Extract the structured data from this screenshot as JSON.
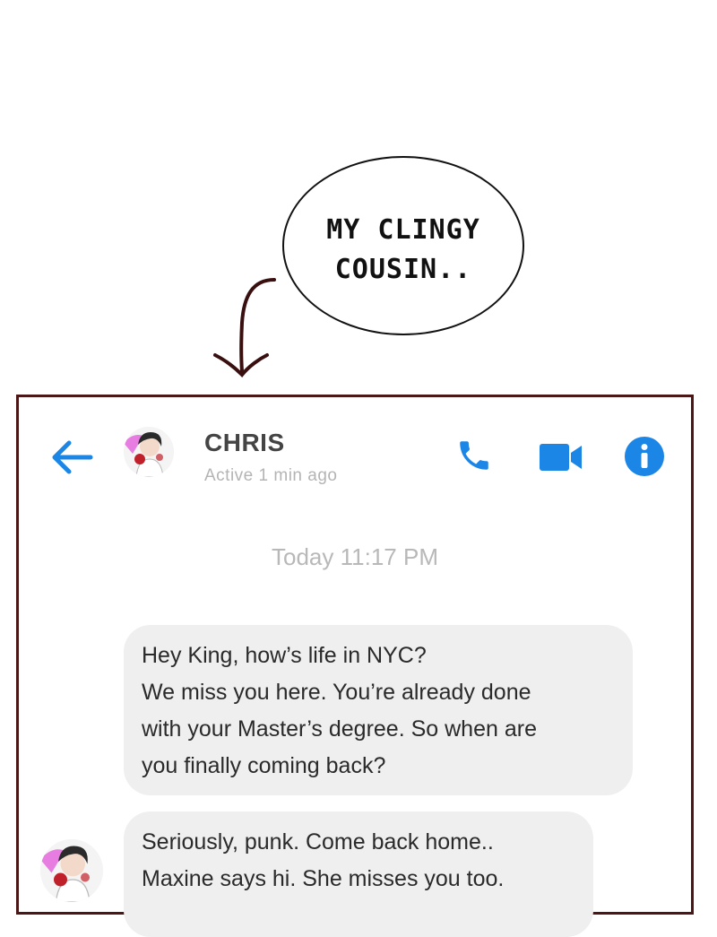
{
  "caption": {
    "line1": "MY CLINGY",
    "line2": "COUSIN.."
  },
  "chat": {
    "contact_name": "CHRIS",
    "status": "Active 1 min ago",
    "timestamp": "Today 11:17 PM",
    "messages": [
      {
        "lines": [
          "Hey King, how’s life in NYC?",
          "We miss you here. You’re already done",
          "with your Master’s degree. So when are",
          "you finally coming back?"
        ]
      },
      {
        "lines": [
          "Seriously, punk. Come back home..",
          "Maxine says hi. She misses you too."
        ]
      }
    ],
    "icons": [
      "back-arrow-icon",
      "phone-icon",
      "video-camera-icon",
      "info-icon"
    ],
    "accent_color": "#1c86e6"
  }
}
